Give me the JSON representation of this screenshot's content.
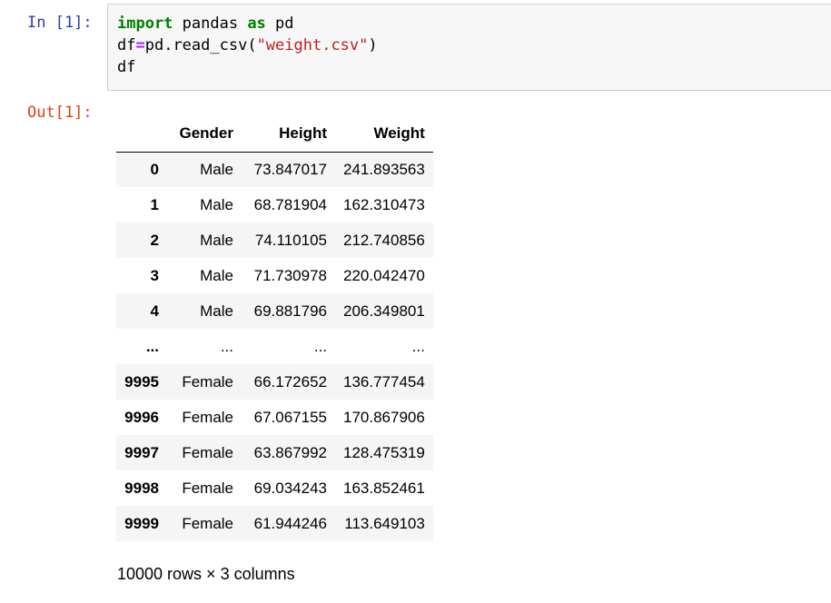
{
  "input_cell": {
    "prompt": "In [1]:",
    "lines": [
      [
        {
          "t": "import",
          "c": "kw"
        },
        {
          "t": " pandas ",
          "c": ""
        },
        {
          "t": "as",
          "c": "kw"
        },
        {
          "t": " pd",
          "c": ""
        }
      ],
      [
        {
          "t": "df",
          "c": ""
        },
        {
          "t": "=",
          "c": "op"
        },
        {
          "t": "pd.read_csv(",
          "c": ""
        },
        {
          "t": "\"weight.csv\"",
          "c": "str"
        },
        {
          "t": ")",
          "c": ""
        }
      ],
      [
        {
          "t": "df",
          "c": ""
        }
      ]
    ]
  },
  "output_cell": {
    "prompt": "Out[1]:",
    "table": {
      "columns": [
        "",
        "Gender",
        "Height",
        "Weight"
      ],
      "rows": [
        [
          "0",
          "Male",
          "73.847017",
          "241.893563"
        ],
        [
          "1",
          "Male",
          "68.781904",
          "162.310473"
        ],
        [
          "2",
          "Male",
          "74.110105",
          "212.740856"
        ],
        [
          "3",
          "Male",
          "71.730978",
          "220.042470"
        ],
        [
          "4",
          "Male",
          "69.881796",
          "206.349801"
        ],
        [
          "...",
          "...",
          "...",
          "..."
        ],
        [
          "9995",
          "Female",
          "66.172652",
          "136.777454"
        ],
        [
          "9996",
          "Female",
          "67.067155",
          "170.867906"
        ],
        [
          "9997",
          "Female",
          "63.867992",
          "128.475319"
        ],
        [
          "9998",
          "Female",
          "69.034243",
          "163.852461"
        ],
        [
          "9999",
          "Female",
          "61.944246",
          "113.649103"
        ]
      ]
    },
    "footer": "10000 rows × 3 columns"
  },
  "colors": {
    "in_prompt": "#303f9f",
    "out_prompt": "#d84315",
    "keyword": "#008000",
    "operator": "#aa22ff",
    "string": "#ba2121",
    "cell_background": "#f7f7f7",
    "striped_row": "#f5f5f5"
  }
}
